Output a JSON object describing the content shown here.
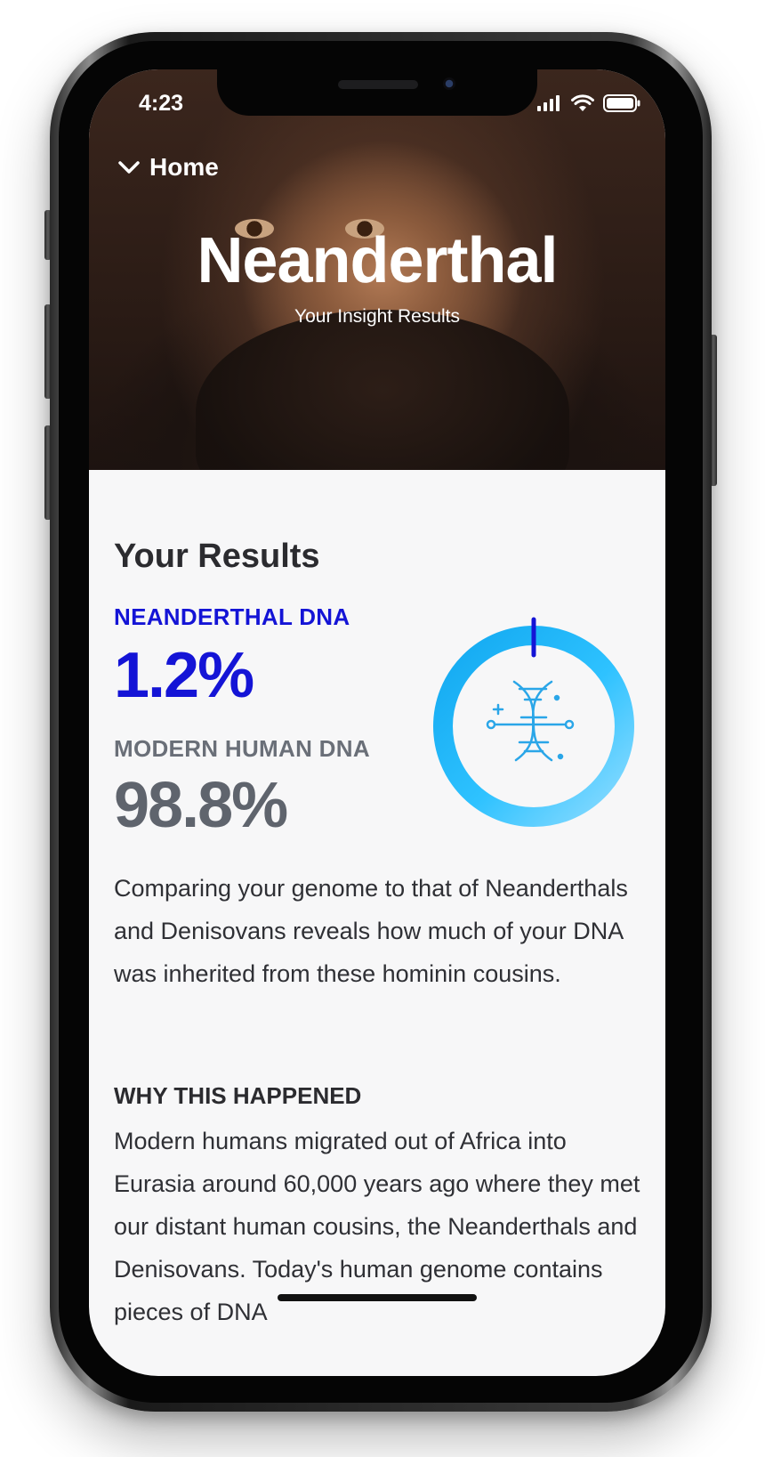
{
  "status": {
    "time": "4:23"
  },
  "nav": {
    "back_label": "Home"
  },
  "hero": {
    "title": "Neanderthal",
    "subtitle": "Your Insight Results"
  },
  "results": {
    "heading": "Your Results",
    "neanderthal_label": "NEANDERTHAL DNA",
    "neanderthal_value": "1.2%",
    "modern_label": "MODERN HUMAN DNA",
    "modern_value": "98.8%",
    "neanderthal_fraction": 0.012
  },
  "description": "Comparing your genome to that of Neanderthals and Denisovans reveals how much of your DNA was inherited from these hominin cousins.",
  "why": {
    "heading": "WHY THIS HAPPENED",
    "text": "Modern humans migrated out of Africa into Eurasia around 60,000 years ago where they met our distant human cousins, the Neanderthals and Denisovans. Today's human genome contains pieces of DNA"
  },
  "colors": {
    "accent_blue": "#1414d6",
    "ring_light": "#7fd6ff",
    "ring_dark": "#12a8f0",
    "gray_text": "#5f646d"
  },
  "icons": {
    "back": "chevron-down-icon",
    "center": "dna-helix-icon"
  }
}
